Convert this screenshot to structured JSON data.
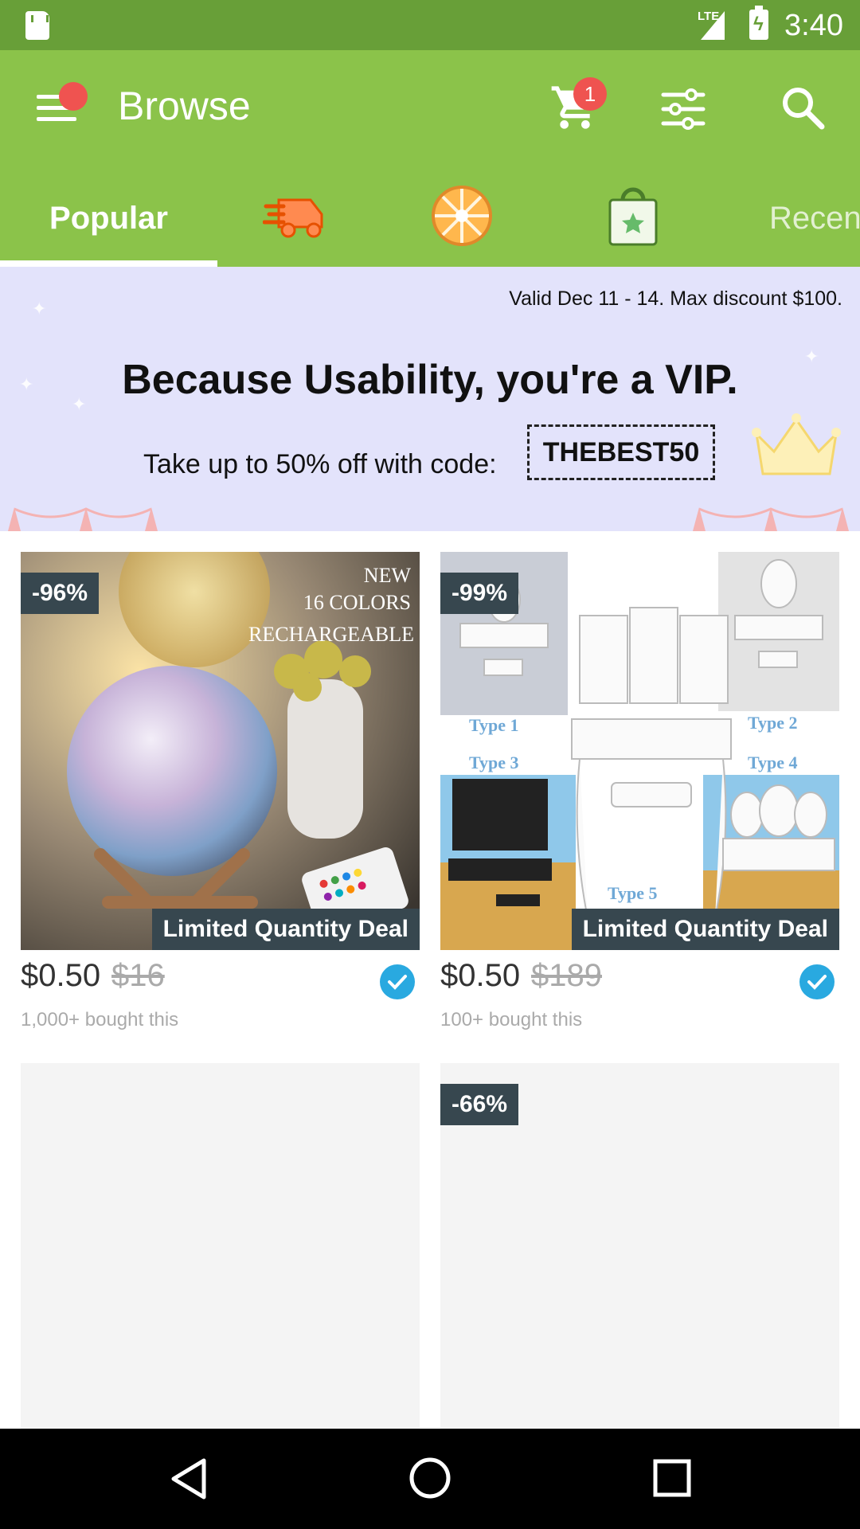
{
  "status_bar": {
    "network": "LTE",
    "time": "3:40"
  },
  "app_bar": {
    "title": "Browse",
    "cart_count": "1"
  },
  "tabs": [
    {
      "label": "Popular",
      "selected": true
    },
    {
      "icon": "express-truck-icon"
    },
    {
      "icon": "wheel-icon"
    },
    {
      "icon": "shopping-bag-star-icon"
    },
    {
      "label": "Recen"
    }
  ],
  "banner": {
    "valid": "Valid Dec 11 - 14. Max discount $100.",
    "headline": "Because Usability, you're a VIP.",
    "offer": "Take up to 50% off with code:",
    "code": "THEBEST50"
  },
  "products": [
    {
      "discount": "-96%",
      "badge": "Limited Quantity Deal",
      "price": "$0.50",
      "old_price": "$16",
      "bought": "1,000+ bought this",
      "image_text": [
        "NEW",
        "16 COLORS",
        "RECHARGEABLE"
      ]
    },
    {
      "discount": "-99%",
      "badge": "Limited Quantity Deal",
      "price": "$0.50",
      "old_price": "$189",
      "bought": "100+ bought this",
      "image_text": [
        "Type 1",
        "Type 2",
        "Type 3",
        "Type 4",
        "Type 5"
      ]
    },
    {
      "discount": ""
    },
    {
      "discount": "-66%"
    }
  ],
  "colors": {
    "status_bar": "#689f38",
    "app_bar": "#8bc34a",
    "badge": "#ef5350",
    "banner": "#e3e3fb",
    "deal_tag": "#37474f",
    "verified": "#29a9e0"
  }
}
